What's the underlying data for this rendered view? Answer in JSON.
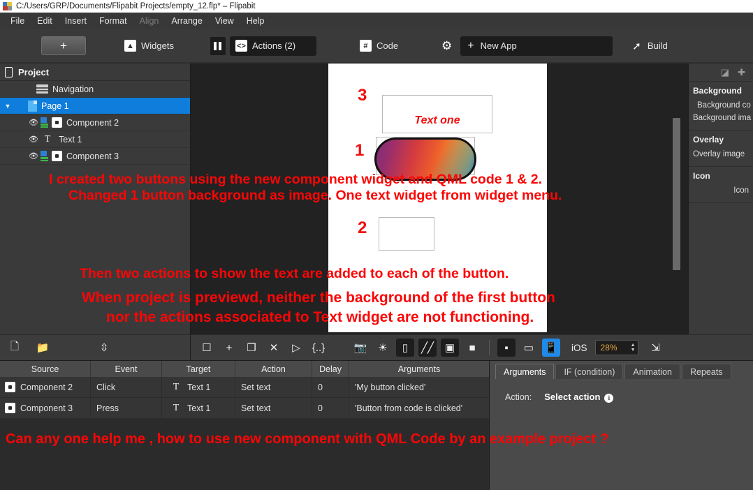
{
  "window": {
    "title": "C:/Users/GRP/Documents/Flipabit Projects/empty_12.flp* – Flipabit"
  },
  "menubar": {
    "items": [
      {
        "label": "File",
        "disabled": false
      },
      {
        "label": "Edit",
        "disabled": false
      },
      {
        "label": "Insert",
        "disabled": false
      },
      {
        "label": "Format",
        "disabled": false
      },
      {
        "label": "Align",
        "disabled": true
      },
      {
        "label": "Arrange",
        "disabled": false
      },
      {
        "label": "View",
        "disabled": false
      },
      {
        "label": "Help",
        "disabled": false
      }
    ]
  },
  "toolbar": {
    "add_label": "+",
    "widgets_label": "Widgets",
    "widgets_icon": "image-icon",
    "pause_icon": "pause-icon",
    "actions_label": "Actions (2)",
    "actions_icon": "code-brackets-icon",
    "code_label": "Code",
    "code_icon": "hash-grid-icon",
    "settings_icon": "gear-icon",
    "newapp_label": "New App",
    "newapp_plus": "+",
    "build_label": "Build",
    "build_icon": "hammer-icon"
  },
  "project_panel": {
    "title": "Project",
    "title_icon": "phone-icon",
    "tree": [
      {
        "label": "Navigation",
        "icon": "navigation-icon",
        "level": 1,
        "selected": false,
        "eye": false,
        "arrow": ""
      },
      {
        "label": "Page 1",
        "icon": "page-icon",
        "level": 1,
        "selected": true,
        "eye": false,
        "arrow": "▼"
      },
      {
        "label": "Component 2",
        "icon": "component-button-icon",
        "level": 2,
        "selected": false,
        "eye": true,
        "arrow": ""
      },
      {
        "label": "Text 1",
        "icon": "text-icon",
        "level": 2,
        "selected": false,
        "eye": true,
        "arrow": ""
      },
      {
        "label": "Component 3",
        "icon": "component-button-icon",
        "level": 2,
        "selected": false,
        "eye": true,
        "arrow": ""
      }
    ]
  },
  "canvas": {
    "markers": {
      "text_widget": "3",
      "image_button": "1",
      "plain_button": "2"
    },
    "text_widget_value": "Text one"
  },
  "properties_panel": {
    "header_icons": [
      "cube-icon",
      "move-icon"
    ],
    "sections": [
      {
        "title": "Background",
        "rows": [
          "Background co",
          "Background ima"
        ]
      },
      {
        "title": "Overlay",
        "rows": [
          "Overlay image"
        ]
      },
      {
        "title": "Icon",
        "rows": [
          "Icon"
        ]
      }
    ]
  },
  "editor_toolbar": {
    "left": [
      "new-file-icon",
      "new-folder-icon",
      "split-vertical-icon"
    ],
    "middle": [
      "page-icon",
      "add-icon",
      "duplicate-icon",
      "delete-icon",
      "play-box-icon",
      "code-snippet-icon",
      "screenshot-icon",
      "brightness-icon",
      "phone-portrait-icon",
      "pattern-icon",
      "selection-icon",
      "magnet-icon"
    ],
    "device_buttons": [
      "device-dot-icon",
      "device-landscape-icon",
      "device-multi-icon"
    ],
    "platform_label": "iOS",
    "zoom_value": "28%",
    "fit_icon": "fit-screen-icon"
  },
  "actions_table": {
    "columns": [
      "Source",
      "Event",
      "Target",
      "Action",
      "Delay",
      "Arguments"
    ],
    "rows": [
      {
        "source": "Component 2",
        "source_icon": "button-icon",
        "event": "Click",
        "target": "Text 1",
        "target_icon": "text-icon",
        "action": "Set text",
        "delay": "0",
        "arguments": "'My button clicked'"
      },
      {
        "source": "Component 3",
        "source_icon": "button-icon",
        "event": "Press",
        "target": "Text 1",
        "target_icon": "text-icon",
        "action": "Set text",
        "delay": "0",
        "arguments": "'Button from code is clicked'"
      }
    ]
  },
  "props_tabs": {
    "tabs": [
      {
        "label": "Arguments",
        "active": true
      },
      {
        "label": "IF (condition)",
        "active": false
      },
      {
        "label": "Animation",
        "active": false
      },
      {
        "label": "Repeats",
        "active": false
      }
    ],
    "action_key": "Action:",
    "action_value": "Select action",
    "info_icon": "info-icon"
  },
  "annotations": {
    "line1": "I created two buttons using the new component widget and QML code 1 & 2.",
    "line2": "Changed 1 button background as image. One text widget from widget menu.",
    "line3": "Then two actions to show the text are added to each of the button.",
    "line4": "When project is previewd, neither the background of the first button",
    "line5": "nor the actions associated to Text widget are not functioning.",
    "line6": "Can any one help me , how to use new component with  QML Code  by an example project ?"
  },
  "colors": {
    "accent_blue": "#0f7ddb",
    "annotation_red": "#fb0606",
    "panel_bg": "#3a3a3a",
    "canvas_bg": "#222222"
  }
}
